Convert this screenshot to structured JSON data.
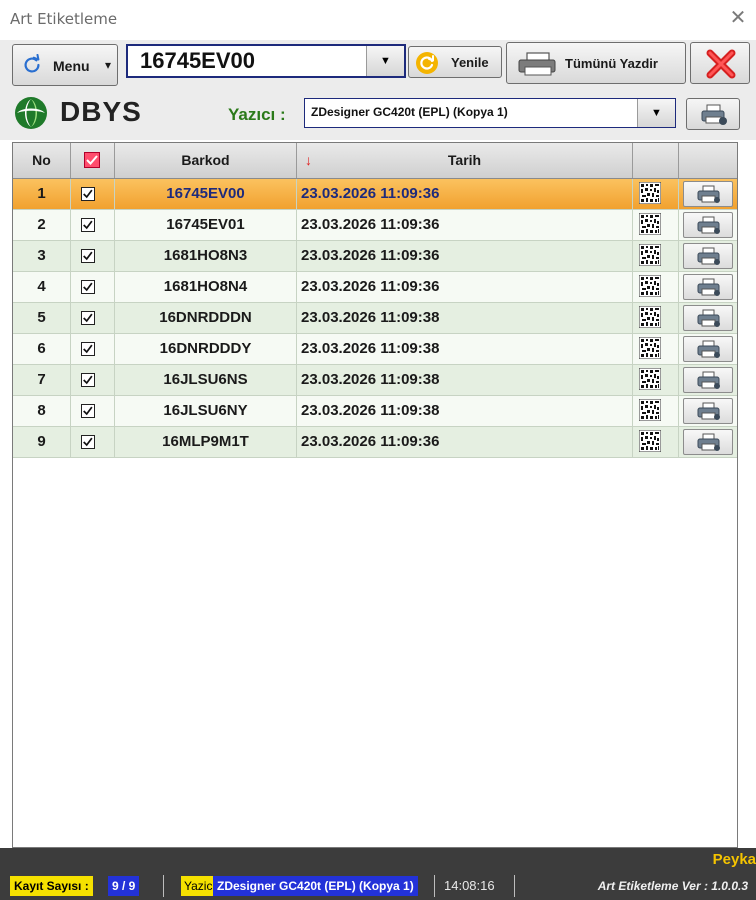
{
  "window": {
    "title": "Art Etiketleme",
    "close_glyph": "✕"
  },
  "toolbar": {
    "menu_label": "Menu",
    "barcode_value": "16745EV00",
    "refresh_label": "Yenile",
    "print_all_label": "Tümünü Yazdir",
    "icons": [
      "refresh-icon",
      "menu-caret-icon",
      "dropdown-arrow-icon",
      "printer-icon",
      "exit-icon"
    ]
  },
  "printer_row": {
    "logo_text": "DBYS",
    "printer_label": "Yazıcı :",
    "printer_value": "ZDesigner GC420t (EPL) (Kopya 1)"
  },
  "grid": {
    "headers": {
      "no": "No",
      "barcode": "Barkod",
      "date": "Tarih"
    },
    "sort_column": "Tarih",
    "rows": [
      {
        "no": "1",
        "checked": true,
        "barcode": "16745EV00",
        "date": "23.03.2026 11:09:36",
        "selected": true
      },
      {
        "no": "2",
        "checked": true,
        "barcode": "16745EV01",
        "date": "23.03.2026 11:09:36"
      },
      {
        "no": "3",
        "checked": true,
        "barcode": "1681HO8N3",
        "date": "23.03.2026 11:09:36"
      },
      {
        "no": "4",
        "checked": true,
        "barcode": "1681HO8N4",
        "date": "23.03.2026 11:09:36"
      },
      {
        "no": "5",
        "checked": true,
        "barcode": "16DNRDDDN",
        "date": "23.03.2026 11:09:38"
      },
      {
        "no": "6",
        "checked": true,
        "barcode": "16DNRDDDY",
        "date": "23.03.2026 11:09:38"
      },
      {
        "no": "7",
        "checked": true,
        "barcode": "16JLSU6NS",
        "date": "23.03.2026 11:09:38"
      },
      {
        "no": "8",
        "checked": true,
        "barcode": "16JLSU6NY",
        "date": "23.03.2026 11:09:38"
      },
      {
        "no": "9",
        "checked": true,
        "barcode": "16MLP9M1T",
        "date": "23.03.2026 11:09:36"
      }
    ]
  },
  "statusbar": {
    "brand": "Peyka",
    "count_label": "Kayıt Sayısı :",
    "count_value": "9 / 9",
    "printer_label": "Yazici :",
    "printer_value": "ZDesigner GC420t (EPL) (Kopya 1)",
    "time": "14:08:16",
    "version": "Art Etiketleme Ver : 1.0.0.3"
  },
  "colors": {
    "selected_row": "#f1a12f",
    "alt_row": "#e5efe1",
    "accent_blue": "#1d2a7c",
    "yazici_green": "#2b7a1a",
    "status_yellow": "#f5e100",
    "status_blue": "#2332d8",
    "brand_yellow": "#f5c400"
  }
}
